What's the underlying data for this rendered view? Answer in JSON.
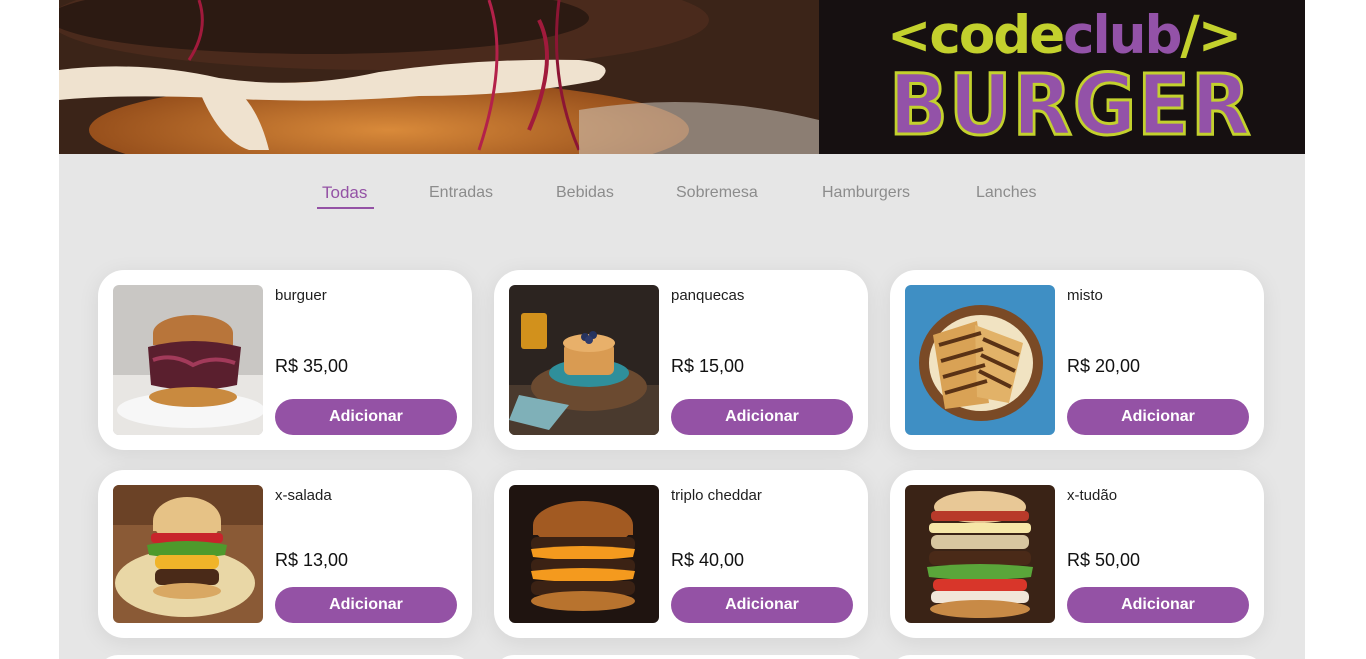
{
  "banner": {
    "logo_open": "<",
    "logo_code": "code",
    "logo_club": "club",
    "logo_close": "/>",
    "logo_burger": "BURGER"
  },
  "tabs": [
    {
      "label": "Todas",
      "active": true
    },
    {
      "label": "Entradas",
      "active": false
    },
    {
      "label": "Bebidas",
      "active": false
    },
    {
      "label": "Sobremesa",
      "active": false
    },
    {
      "label": "Hamburgers",
      "active": false
    },
    {
      "label": "Lanches",
      "active": false
    }
  ],
  "products": [
    {
      "name": "burguer",
      "price": "R$ 35,00",
      "button": "Adicionar",
      "image": "burger-photo"
    },
    {
      "name": "panquecas",
      "price": "R$ 15,00",
      "button": "Adicionar",
      "image": "pancakes-photo"
    },
    {
      "name": "misto",
      "price": "R$ 20,00",
      "button": "Adicionar",
      "image": "toasted-sandwich-photo"
    },
    {
      "name": "x-salada",
      "price": "R$ 13,00",
      "button": "Adicionar",
      "image": "salad-burger-photo"
    },
    {
      "name": "triplo cheddar",
      "price": "R$ 40,00",
      "button": "Adicionar",
      "image": "cheddar-burger-photo"
    },
    {
      "name": "x-tudão",
      "price": "R$ 50,00",
      "button": "Adicionar",
      "image": "loaded-burger-photo"
    }
  ],
  "colors": {
    "accent": "#9452a5",
    "logo_green": "#c3d12d",
    "page_background": "#e6e6e6",
    "card_background": "#ffffff"
  }
}
